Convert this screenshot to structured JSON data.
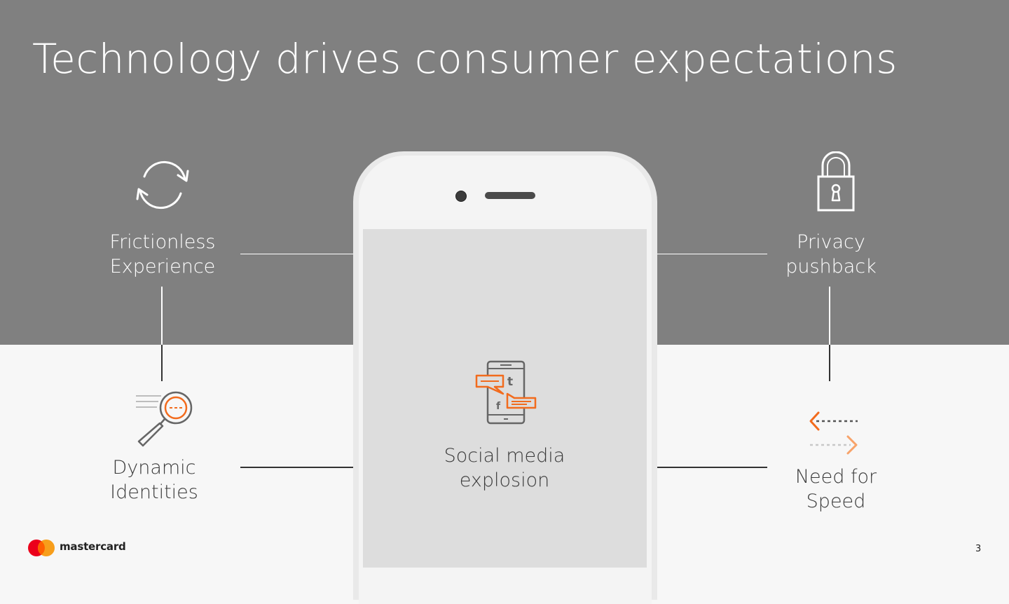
{
  "slide": {
    "title": "Technology drives consumer expectations",
    "page_number": "3"
  },
  "items": {
    "frictionless": {
      "line1": "Frictionless",
      "line2": "Experience",
      "icon": "refresh-icon"
    },
    "privacy": {
      "line1": "Privacy",
      "line2": "pushback",
      "icon": "padlock-icon"
    },
    "dynamic": {
      "line1": "Dynamic",
      "line2": "Identities",
      "icon": "magnifier-icon"
    },
    "speed": {
      "line1": "Need for",
      "line2": "Speed",
      "icon": "arrows-icon"
    },
    "social": {
      "line1": "Social media",
      "line2": "explosion",
      "icon": "social-phone-icon"
    }
  },
  "brand": {
    "name": "mastercard"
  },
  "colors": {
    "top_band": "#808080",
    "bottom_band": "#f7f7f7",
    "accent_orange": "#f26b1d",
    "accent_light_orange": "#f8a36a"
  }
}
